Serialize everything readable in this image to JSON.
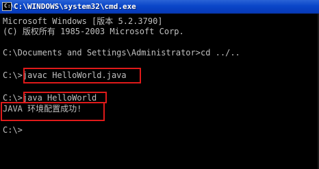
{
  "window": {
    "title": "C:\\WINDOWS\\system32\\cmd.exe",
    "icon": "cmd-icon"
  },
  "console": {
    "lines": [
      "Microsoft Windows [版本 5.2.3790]",
      "(C) 版权所有 1985-2003 Microsoft Corp.",
      "",
      "C:\\Documents and Settings\\Administrator>cd ../..",
      "",
      "C:\\>javac HelloWorld.java",
      "",
      "C:\\>java HelloWorld",
      "JAVA 环境配置成功!",
      "",
      "C:\\>"
    ]
  },
  "colors": {
    "console_text": "#c0c0c0",
    "console_background": "#000000",
    "titlebar": "#0a46c9",
    "highlight_border": "#e01a1a"
  }
}
